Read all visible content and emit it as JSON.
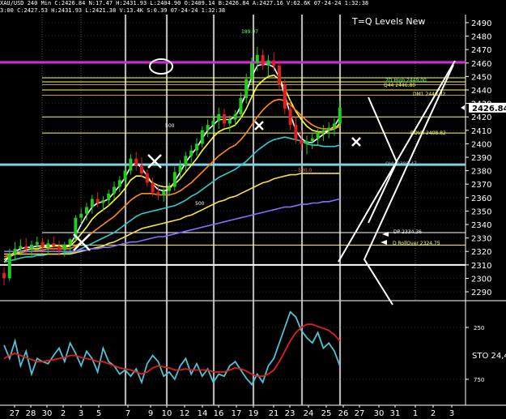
{
  "header": {
    "line1": "XAU/USD 240 Min C:2426.84 N:17.47 H:2431.93 L:2404.90 O:2409.14 B:2426.84 A:2427.16 V:62.6K 07-24-24 1:32:38",
    "line2": "3:00 C:2427.53 H:2431.93 L:2421.38 V:13.4K S:0.39 07-24-24 1:32:38"
  },
  "chart_data": [
    {
      "type": "line",
      "title": "T=Q Levels New",
      "ylim": [
        2284,
        2496
      ],
      "yticks": [
        2290,
        2300,
        2310,
        2320,
        2330,
        2340,
        2350,
        2360,
        2370,
        2380,
        2390,
        2400,
        2410,
        2420,
        2430,
        2440,
        2450,
        2460,
        2470,
        2480,
        2490
      ],
      "last_price_label": "2426.84",
      "last_price": 2426.84,
      "x_labels": [
        "27",
        "28",
        "30",
        "2",
        "3",
        "5",
        "7",
        "9",
        "10",
        "12",
        "14",
        "16",
        "17",
        "19",
        "21",
        "23",
        "24",
        "25",
        "26",
        "27",
        "30",
        "31",
        "1",
        "2",
        "3"
      ],
      "hlines": [
        {
          "y": 2460.5,
          "color": "#d22ad2"
        },
        {
          "y": 2449,
          "color": "#ffff66"
        },
        {
          "y": 2446,
          "color": "#ffff66"
        },
        {
          "y": 2440,
          "color": "#ffff66"
        },
        {
          "y": 2420,
          "color": "#ffff66"
        },
        {
          "y": 2408,
          "color": "#ffff66"
        },
        {
          "y": 2384.5,
          "color": "#7fd0e0"
        },
        {
          "y": 2334,
          "color": "#ffffff"
        },
        {
          "y": 2324.75,
          "color": "#ffff66"
        },
        {
          "y": 2310,
          "color": "#ffffff"
        }
      ],
      "annotations": [
        {
          "text": "2D High 2449.00",
          "color": "#66ff66"
        },
        {
          "text": "Q44 2446.80",
          "color": "#ffff66"
        },
        {
          "text": "DM1 2440.32",
          "color": "#ffff66"
        },
        {
          "text": "ROVR 2408.82",
          "color": "#ffff66"
        },
        {
          "text": "QVL 2385.47",
          "color": "#7fd0e0"
        },
        {
          "text": "DP 2334.36",
          "color": "#ffffff"
        },
        {
          "text": "D RollOver 2324.75",
          "color": "#ffff66"
        },
        {
          "text": "189.97",
          "color": "#66ff66"
        },
        {
          "text": "500",
          "color": "#ffffff"
        },
        {
          "text": "500",
          "color": "#ffffff"
        },
        {
          "text": "- 500.0",
          "color": "#ff6666"
        }
      ],
      "candles": [
        [
          2304,
          2308,
          2295,
          2300
        ],
        [
          2300,
          2322,
          2298,
          2318
        ],
        [
          2318,
          2327,
          2313,
          2322
        ],
        [
          2322,
          2329,
          2317,
          2324
        ],
        [
          2324,
          2330,
          2318,
          2322
        ],
        [
          2322,
          2328,
          2316,
          2325
        ],
        [
          2325,
          2331,
          2320,
          2327
        ],
        [
          2327,
          2330,
          2321,
          2323
        ],
        [
          2323,
          2329,
          2318,
          2326
        ],
        [
          2326,
          2331,
          2320,
          2324
        ],
        [
          2324,
          2328,
          2317,
          2321
        ],
        [
          2321,
          2327,
          2316,
          2325
        ],
        [
          2325,
          2330,
          2320,
          2329
        ],
        [
          2329,
          2347,
          2327,
          2345
        ],
        [
          2345,
          2352,
          2340,
          2348
        ],
        [
          2348,
          2356,
          2343,
          2353
        ],
        [
          2353,
          2362,
          2348,
          2359
        ],
        [
          2359,
          2364,
          2353,
          2356
        ],
        [
          2356,
          2361,
          2350,
          2358
        ],
        [
          2358,
          2366,
          2354,
          2363
        ],
        [
          2363,
          2372,
          2359,
          2368
        ],
        [
          2368,
          2376,
          2364,
          2373
        ],
        [
          2373,
          2383,
          2369,
          2380
        ],
        [
          2380,
          2392,
          2377,
          2389
        ],
        [
          2389,
          2394,
          2380,
          2384
        ],
        [
          2384,
          2390,
          2375,
          2378
        ],
        [
          2378,
          2381,
          2368,
          2371
        ],
        [
          2371,
          2375,
          2361,
          2364
        ],
        [
          2364,
          2369,
          2358,
          2362
        ],
        [
          2362,
          2367,
          2357,
          2365
        ],
        [
          2365,
          2371,
          2361,
          2368
        ],
        [
          2368,
          2383,
          2365,
          2379
        ],
        [
          2379,
          2388,
          2374,
          2384
        ],
        [
          2384,
          2394,
          2380,
          2391
        ],
        [
          2391,
          2399,
          2386,
          2395
        ],
        [
          2395,
          2404,
          2391,
          2400
        ],
        [
          2400,
          2413,
          2397,
          2410
        ],
        [
          2410,
          2418,
          2405,
          2414
        ],
        [
          2414,
          2422,
          2408,
          2417
        ],
        [
          2417,
          2427,
          2411,
          2422
        ],
        [
          2422,
          2426,
          2412,
          2415
        ],
        [
          2415,
          2421,
          2409,
          2418
        ],
        [
          2418,
          2425,
          2413,
          2422
        ],
        [
          2422,
          2438,
          2419,
          2434
        ],
        [
          2434,
          2452,
          2430,
          2448
        ],
        [
          2448,
          2464,
          2444,
          2460
        ],
        [
          2460,
          2472,
          2454,
          2466
        ],
        [
          2466,
          2470,
          2455,
          2458
        ],
        [
          2458,
          2466,
          2450,
          2462
        ],
        [
          2462,
          2468,
          2454,
          2458
        ],
        [
          2458,
          2462,
          2440,
          2444
        ],
        [
          2444,
          2448,
          2422,
          2426
        ],
        [
          2426,
          2432,
          2410,
          2414
        ],
        [
          2414,
          2420,
          2400,
          2403
        ],
        [
          2403,
          2410,
          2395,
          2400
        ],
        [
          2400,
          2406,
          2392,
          2402
        ],
        [
          2402,
          2408,
          2396,
          2404
        ],
        [
          2404,
          2411,
          2399,
          2408
        ],
        [
          2408,
          2414,
          2402,
          2410
        ],
        [
          2410,
          2416,
          2404,
          2412
        ],
        [
          2412,
          2419,
          2406,
          2415
        ],
        [
          2415,
          2432,
          2413,
          2427
        ]
      ],
      "series": [
        {
          "color": "#ffffff",
          "values": [
            2312,
            2316,
            2320,
            2322,
            2323,
            2323,
            2324,
            2324,
            2324,
            2325,
            2324,
            2323,
            2325,
            2332,
            2340,
            2347,
            2353,
            2356,
            2357,
            2359,
            2364,
            2369,
            2375,
            2383,
            2386,
            2382,
            2376,
            2370,
            2366,
            2365,
            2366,
            2372,
            2379,
            2386,
            2392,
            2397,
            2404,
            2410,
            2414,
            2418,
            2418,
            2418,
            2420,
            2428,
            2438,
            2450,
            2458,
            2459,
            2459,
            2457,
            2449,
            2436,
            2422,
            2410,
            2404,
            2401,
            2401,
            2404,
            2407,
            2410,
            2413,
            2420
          ]
        },
        {
          "color": "#ffff33",
          "values": [
            2314,
            2316,
            2318,
            2320,
            2321,
            2322,
            2322,
            2323,
            2323,
            2324,
            2324,
            2323,
            2324,
            2328,
            2333,
            2338,
            2344,
            2348,
            2351,
            2354,
            2358,
            2362,
            2367,
            2373,
            2376,
            2376,
            2374,
            2371,
            2369,
            2368,
            2368,
            2370,
            2374,
            2379,
            2384,
            2389,
            2395,
            2400,
            2405,
            2409,
            2411,
            2412,
            2414,
            2419,
            2426,
            2435,
            2443,
            2447,
            2450,
            2451,
            2448,
            2441,
            2432,
            2424,
            2418,
            2413,
            2410,
            2409,
            2409,
            2410,
            2411,
            2415
          ]
        },
        {
          "color": "#ff8c1a",
          "values": [
            2316,
            2317,
            2318,
            2319,
            2320,
            2320,
            2321,
            2321,
            2322,
            2322,
            2322,
            2322,
            2322,
            2324,
            2327,
            2330,
            2334,
            2337,
            2340,
            2343,
            2346,
            2350,
            2354,
            2358,
            2361,
            2363,
            2363,
            2363,
            2362,
            2362,
            2362,
            2363,
            2365,
            2368,
            2371,
            2375,
            2379,
            2383,
            2387,
            2391,
            2394,
            2397,
            2399,
            2403,
            2408,
            2414,
            2420,
            2425,
            2429,
            2432,
            2433,
            2432,
            2429,
            2425,
            2421,
            2417,
            2414,
            2412,
            2411,
            2411,
            2411,
            2413
          ]
        },
        {
          "color": "#33cccc",
          "values": [
            2312,
            2313,
            2314,
            2315,
            2316,
            2316,
            2317,
            2317,
            2318,
            2318,
            2318,
            2319,
            2319,
            2320,
            2322,
            2324,
            2326,
            2328,
            2330,
            2332,
            2334,
            2337,
            2340,
            2343,
            2346,
            2348,
            2349,
            2350,
            2351,
            2352,
            2353,
            2354,
            2356,
            2358,
            2361,
            2363,
            2366,
            2369,
            2372,
            2375,
            2377,
            2379,
            2381,
            2384,
            2387,
            2391,
            2395,
            2398,
            2401,
            2403,
            2404,
            2405,
            2404,
            2403,
            2402,
            2400,
            2399,
            2399,
            2398,
            2398,
            2398,
            2399
          ]
        },
        {
          "color": "#f2e04a",
          "values": [
            2318,
            2318,
            2318,
            2318,
            2318,
            2318,
            2318,
            2318,
            2318,
            2318,
            2318,
            2318,
            2318,
            2319,
            2320,
            2321,
            2322,
            2323,
            2324,
            2326,
            2327,
            2329,
            2331,
            2333,
            2335,
            2337,
            2338,
            2339,
            2340,
            2341,
            2342,
            2343,
            2344,
            2346,
            2347,
            2349,
            2351,
            2353,
            2355,
            2357,
            2358,
            2360,
            2361,
            2363,
            2365,
            2367,
            2369,
            2371,
            2372,
            2374,
            2375,
            2376,
            2377,
            2377,
            2378,
            2378,
            2378,
            2378,
            2378,
            2378,
            2378,
            2378
          ]
        },
        {
          "color": "#8a6cff",
          "values": [
            2320,
            2320,
            2320,
            2320,
            2320,
            2320,
            2320,
            2320,
            2320,
            2320,
            2320,
            2320,
            2320,
            2320,
            2321,
            2321,
            2322,
            2322,
            2323,
            2323,
            2324,
            2325,
            2326,
            2327,
            2327,
            2328,
            2329,
            2330,
            2331,
            2331,
            2332,
            2333,
            2334,
            2335,
            2336,
            2337,
            2338,
            2339,
            2340,
            2341,
            2342,
            2343,
            2344,
            2345,
            2346,
            2347,
            2348,
            2349,
            2350,
            2351,
            2352,
            2353,
            2353,
            2354,
            2355,
            2355,
            2356,
            2356,
            2357,
            2357,
            2358,
            2359
          ]
        }
      ],
      "ylabel": ""
    },
    {
      "type": "line",
      "ylim": [
        100,
        0
      ],
      "yticks": [
        25,
        75
      ],
      "ytick_labels": [
        "250",
        "750"
      ],
      "indicator_label": "STO  24,4",
      "series": [
        {
          "color": "#4dc3d8",
          "values": [
            42,
            55,
            38,
            62,
            48,
            70,
            55,
            58,
            60,
            52,
            45,
            58,
            40,
            50,
            62,
            48,
            55,
            68,
            45,
            58,
            62,
            70,
            66,
            72,
            65,
            78,
            60,
            52,
            58,
            72,
            68,
            75,
            62,
            55,
            70,
            60,
            72,
            65,
            78,
            70,
            72,
            62,
            58,
            66,
            74,
            80,
            70,
            78,
            62,
            55,
            40,
            25,
            10,
            15,
            28,
            35,
            40,
            30,
            45,
            40,
            48,
            62
          ]
        },
        {
          "color": "#e02020",
          "values": [
            55,
            52,
            50,
            52,
            54,
            56,
            58,
            58,
            57,
            56,
            55,
            54,
            52,
            52,
            54,
            55,
            56,
            58,
            58,
            60,
            62,
            64,
            65,
            66,
            68,
            70,
            68,
            64,
            62,
            63,
            64,
            66,
            66,
            65,
            66,
            66,
            66,
            66,
            68,
            68,
            68,
            66,
            64,
            65,
            67,
            70,
            72,
            72,
            70,
            66,
            58,
            48,
            38,
            30,
            25,
            22,
            22,
            24,
            26,
            28,
            32,
            38
          ]
        }
      ]
    }
  ]
}
